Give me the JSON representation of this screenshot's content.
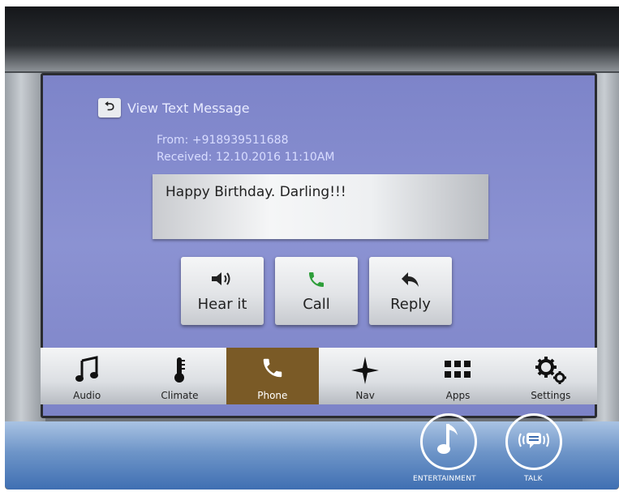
{
  "screen": {
    "title": "View Text Message",
    "back_icon": "back-arrow-icon",
    "from": "From: +918939511688",
    "received": "Received: 12.10.2016 11:10AM",
    "message": "Happy Birthday. Darling!!!"
  },
  "actions": [
    {
      "label": "Hear it",
      "icon": "speaker-icon"
    },
    {
      "label": "Call",
      "icon": "phone-icon",
      "color": "#2e9e3a"
    },
    {
      "label": "Reply",
      "icon": "reply-icon"
    }
  ],
  "nav": [
    {
      "label": "Audio",
      "icon": "music-note-icon"
    },
    {
      "label": "Climate",
      "icon": "thermometer-icon"
    },
    {
      "label": "Phone",
      "icon": "phone-icon",
      "active": true
    },
    {
      "label": "Nav",
      "icon": "compass-star-icon"
    },
    {
      "label": "Apps",
      "icon": "apps-grid-icon"
    },
    {
      "label": "Settings",
      "icon": "gears-icon"
    }
  ],
  "console": {
    "entertainment": "ENTERTAINMENT",
    "talk": "TALK"
  },
  "colors": {
    "screen_bg": "#8288cc",
    "active_tab": "#7a5a26",
    "call_green": "#2e9e3a"
  }
}
